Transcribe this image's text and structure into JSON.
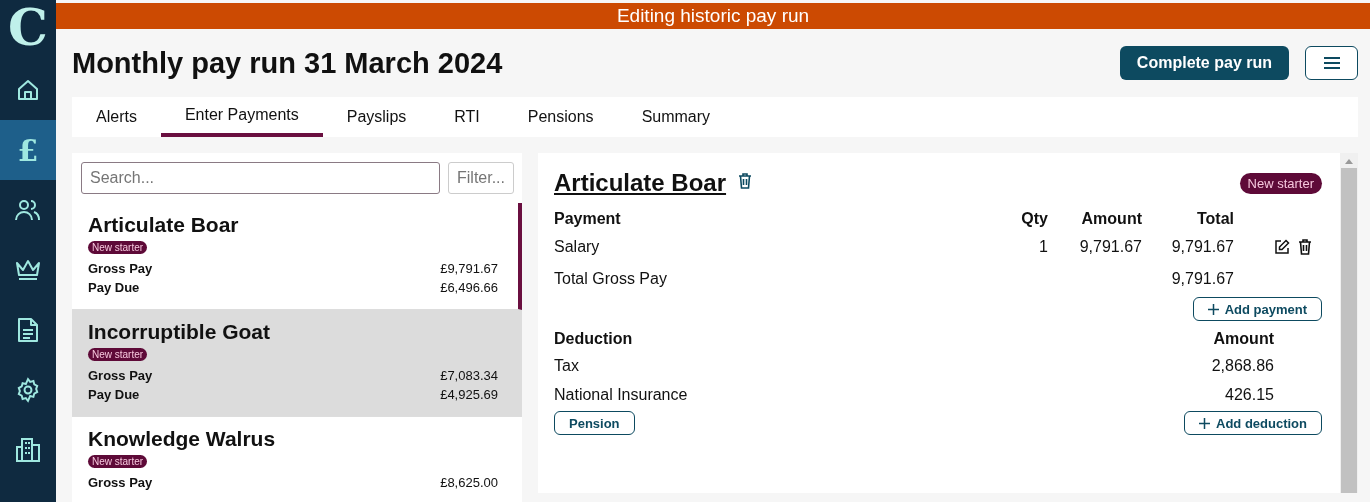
{
  "logo": "C",
  "nav": [
    {
      "kind": "home",
      "selected": false
    },
    {
      "kind": "pound",
      "glyph": "£",
      "selected": true
    },
    {
      "kind": "people",
      "selected": false
    },
    {
      "kind": "crown",
      "selected": false
    },
    {
      "kind": "document",
      "selected": false
    },
    {
      "kind": "gear",
      "selected": false
    },
    {
      "kind": "building",
      "selected": false
    }
  ],
  "banner": "Editing historic pay run",
  "title": "Monthly pay run 31 March 2024",
  "complete_button": "Complete pay run",
  "tabs": [
    {
      "label": "Alerts",
      "selected": false
    },
    {
      "label": "Enter Payments",
      "selected": true
    },
    {
      "label": "Payslips",
      "selected": false
    },
    {
      "label": "RTI",
      "selected": false
    },
    {
      "label": "Pensions",
      "selected": false
    },
    {
      "label": "Summary",
      "selected": false
    }
  ],
  "search": {
    "placeholder": "Search..."
  },
  "filter": {
    "placeholder": "Filter..."
  },
  "employees": [
    {
      "name": "Articulate Boar",
      "badge": "New starter",
      "selected": true,
      "hovered": false,
      "rows": [
        {
          "label": "Gross Pay",
          "value": "£9,791.67"
        },
        {
          "label": "Pay Due",
          "value": "£6,496.66"
        }
      ]
    },
    {
      "name": "Incorruptible Goat",
      "badge": "New starter",
      "selected": false,
      "hovered": true,
      "rows": [
        {
          "label": "Gross Pay",
          "value": "£7,083.34"
        },
        {
          "label": "Pay Due",
          "value": "£4,925.69"
        }
      ]
    },
    {
      "name": "Knowledge Walrus",
      "badge": "New starter",
      "selected": false,
      "hovered": false,
      "rows": [
        {
          "label": "Gross Pay",
          "value": "£8,625.00"
        }
      ]
    }
  ],
  "detail": {
    "name": "Articulate Boar",
    "badge": "New starter",
    "payment_columns": [
      "Payment",
      "Qty",
      "Amount",
      "Total"
    ],
    "payments": [
      {
        "name": "Salary",
        "qty": "1",
        "amount": "9,791.67",
        "total": "9,791.67"
      }
    ],
    "total_label": "Total Gross Pay",
    "total_value": "9,791.67",
    "add_payment": "Add payment",
    "deduction_columns": [
      "Deduction",
      "Amount"
    ],
    "deductions": [
      {
        "name": "Tax",
        "amount": "2,868.86"
      },
      {
        "name": "National Insurance",
        "amount": "426.15"
      }
    ],
    "pension_button": "Pension",
    "add_deduction": "Add deduction"
  }
}
